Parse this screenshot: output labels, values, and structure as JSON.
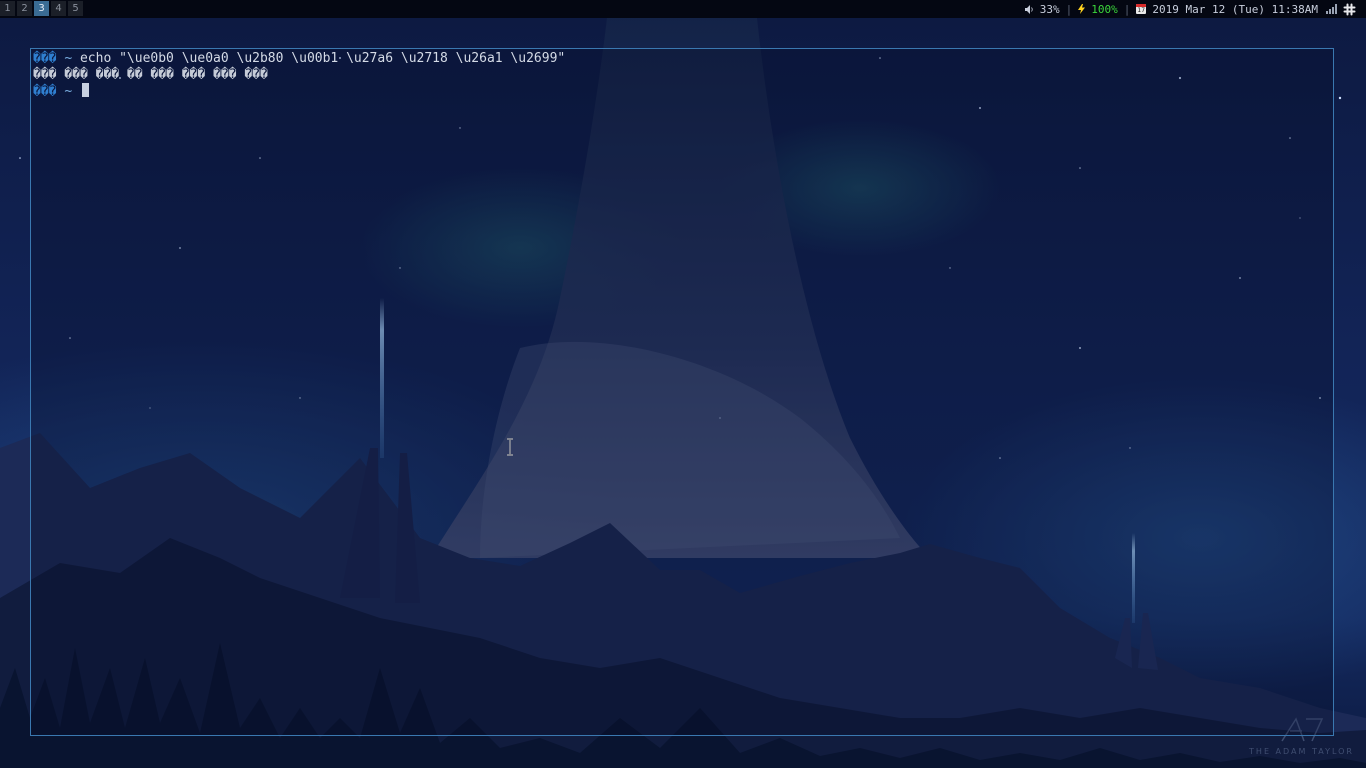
{
  "topbar": {
    "workspaces": [
      {
        "label": "1",
        "active": false
      },
      {
        "label": "2",
        "active": false
      },
      {
        "label": "3",
        "active": true
      },
      {
        "label": "4",
        "active": false
      },
      {
        "label": "5",
        "active": false
      }
    ],
    "volume": {
      "icon": "speaker-icon",
      "value": "33%"
    },
    "battery": {
      "icon": "lightning-icon",
      "value": "100%",
      "color": "#3bd63b"
    },
    "datetime": {
      "icon": "calendar-icon",
      "value": "2019 Mar 12 (Tue) 11:38AM"
    },
    "separator": "|",
    "tray": [
      "signal-bars-icon",
      "slack-icon"
    ]
  },
  "terminal": {
    "border_color": "#3a78b0",
    "prompt_symbol": "���",
    "prompt_dir": "~",
    "lines": [
      {
        "command": "echo \"\\ue0b0 \\ue0a0 \\u2b80 \\u00b1 \\u27a6 \\u2718 \\u26a1 \\u2699\""
      },
      {
        "output": "��� ��� ��� �� ��� ��� ��� ���"
      }
    ]
  },
  "wallpaper": {
    "watermark": "THE ADAM TAYLOR"
  }
}
